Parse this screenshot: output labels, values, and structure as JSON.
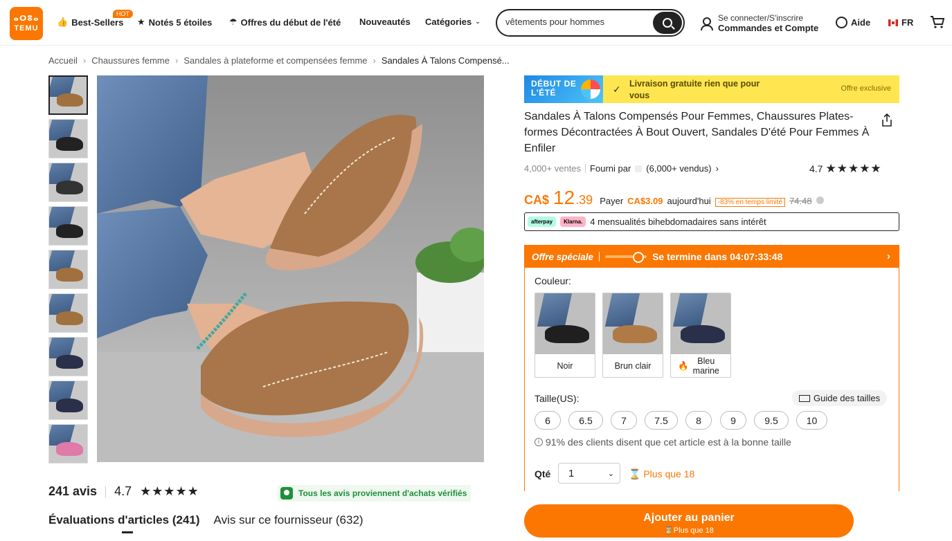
{
  "header": {
    "logo_line1": "ⴰⵔⵓⴰ",
    "logo_line2": "TEMU",
    "nav": [
      {
        "label": "Best-Sellers",
        "icon": "thumbs-up-icon"
      },
      {
        "label": "Notés 5 étoiles",
        "icon": "star-badge-icon"
      },
      {
        "label": "Offres du début de l'été",
        "icon": "umbrella-icon"
      },
      {
        "label": "Nouveautés"
      },
      {
        "label": "Catégories"
      }
    ],
    "hot_badge": "HOT",
    "search_value": "vêtements pour hommes",
    "account_line1": "Se connecter/S'inscrire",
    "account_line2": "Commandes et Compte",
    "help": "Aide",
    "lang": "FR"
  },
  "breadcrumb": [
    "Accueil",
    "Chaussures femme",
    "Sandales à plateforme et compensées femme",
    "Sandales À Talons Compensé..."
  ],
  "thumbnail_colors": [
    "#a0703f",
    "#222",
    "#333",
    "#222",
    "#a0703f",
    "#a0703f",
    "#2a2f4a",
    "#2a2f4a",
    "#e07aa8"
  ],
  "reviews": {
    "count": "241 avis",
    "rating": "4.7",
    "verified": "Tous les avis proviennent d'achats vérifiés",
    "tab1": "Évaluations d'articles (241)",
    "tab2": "Avis sur ce fournisseur (632)"
  },
  "promo": {
    "badge": "DÉBUT DE L'ÉTÉ",
    "text": "Livraison gratuite rien que pour vous",
    "exclusive": "Offre exclusive"
  },
  "product": {
    "title": "Sandales À Talons Compensés Pour Femmes, Chaussures Plates-formes Décontractées À Bout Ouvert, Sandales D'été Pour Femmes À Enfiler",
    "sales": "4,000+ ventes",
    "supplied_by": "Fourni par",
    "sold": "(6,000+ vendus)",
    "rating": "4.7"
  },
  "price": {
    "currency": "CA$",
    "main": "12",
    "cents": ".39",
    "pay_label": "Payer",
    "pay_value": "CA$3.09",
    "today": "aujourd'hui",
    "discount": "-83% en temps limité",
    "old": "74.48"
  },
  "installments": {
    "afterpay": "afterpay",
    "klarna": "Klarna.",
    "text": "4 mensualités bihebdomadaires sans intérêt"
  },
  "offer": {
    "label": "Offre spéciale",
    "ends": "Se termine dans 04:07:33:48",
    "color_label": "Couleur:",
    "colors": [
      {
        "name": "Noir",
        "shoe": "#1f1f1f"
      },
      {
        "name": "Brun clair",
        "shoe": "#b07a46"
      },
      {
        "name": "Bleu marine",
        "shoe": "#2a2f4a"
      }
    ],
    "size_label": "Taille(US):",
    "size_guide": "Guide des tailles",
    "sizes": [
      "6",
      "6.5",
      "7",
      "7.5",
      "8",
      "9",
      "9.5",
      "10"
    ],
    "fit_note": "91% des clients disent que cet article est à la bonne taille",
    "qty_label": "Qté",
    "qty_value": "1",
    "qty_left": "Plus que 18"
  },
  "cart_button": {
    "label": "Ajouter au panier",
    "sub": "Plus que 18"
  }
}
